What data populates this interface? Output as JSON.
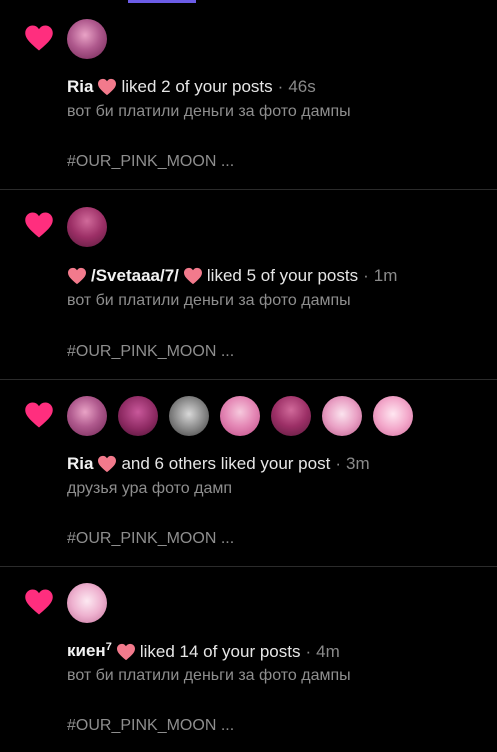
{
  "colors": {
    "heart": "#ff2e7e",
    "mini_heart": "#f27a8c",
    "accent": "#6b5ce7"
  },
  "notifications": [
    {
      "user": "Ria",
      "action": "liked 2 of your posts",
      "time": "46s",
      "post_text": "вот би платили деньги за фото дампы",
      "tag": "#OUR_PINK_MOON ..."
    },
    {
      "user": "/Svetaaa/7/",
      "action": "liked 5 of your posts",
      "time": "1m",
      "post_text": "вот би платили деньги за фото дампы",
      "tag": "#OUR_PINK_MOON ..."
    },
    {
      "user": "Ria",
      "action": "and 6 others liked your post",
      "time": "3m",
      "post_text": "друзья ура фото дамп",
      "tag": "#OUR_PINK_MOON ..."
    },
    {
      "user": "киен",
      "user_sup": "7",
      "action": "liked 14 of your posts",
      "time": "4m",
      "post_text": "вот би платили деньги за фото дампы",
      "tag": "#OUR_PINK_MOON ..."
    }
  ],
  "separator": "·"
}
